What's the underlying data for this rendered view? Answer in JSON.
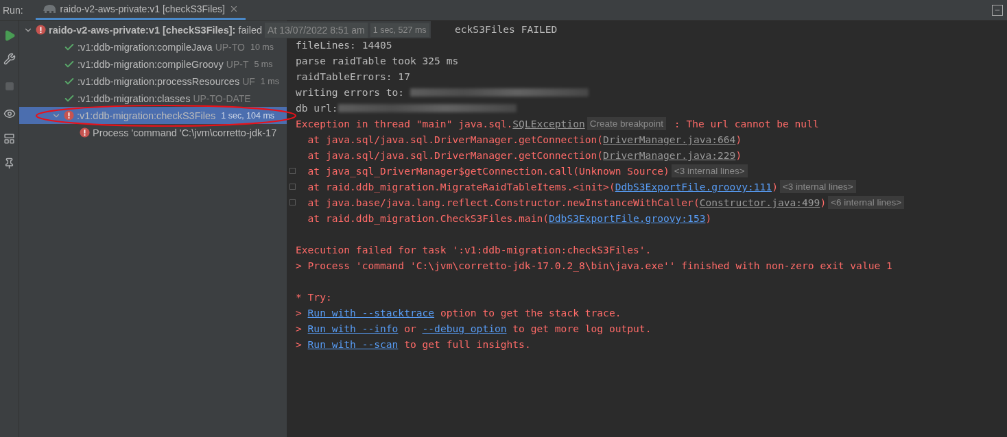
{
  "run_bar": {
    "label": "Run:",
    "tab": {
      "title": "raido-v2-aws-private:v1 [checkS3Files]",
      "selected": true
    }
  },
  "tree": {
    "root": {
      "name": "raido-v2-aws-private:v1 [checkS3Files]:",
      "status": "failed",
      "timestamp": "At 13/07/2022 8:51 am",
      "duration": "1 sec, 527 ms",
      "kind": "error",
      "expanded": true,
      "children": [
        {
          "name": ":v1:ddb-migration:compileJava",
          "status": "UP-TO",
          "duration": "10 ms",
          "kind": "ok",
          "selected": false
        },
        {
          "name": ":v1:ddb-migration:compileGroovy",
          "status": "UP-T",
          "duration": "5 ms",
          "kind": "ok",
          "selected": false
        },
        {
          "name": ":v1:ddb-migration:processResources",
          "status": "UF",
          "duration": "1 ms",
          "kind": "ok",
          "selected": false
        },
        {
          "name": ":v1:ddb-migration:classes",
          "status": "UP-TO-DATE",
          "kind": "ok",
          "selected": false
        },
        {
          "name": ":v1:ddb-migration:checkS3Files",
          "duration": "1 sec, 104 ms",
          "kind": "error",
          "selected": true,
          "expanded": true,
          "children": [
            {
              "name": "Process 'command 'C:\\jvm\\corretto-jdk-17",
              "kind": "error",
              "selected": false
            }
          ]
        }
      ]
    }
  },
  "console": {
    "lines": [
      {
        "kind": "normal",
        "covered_start": true,
        "segments": [
          {
            "kind": "text",
            "text": "eckS3Files FAILED"
          }
        ]
      },
      {
        "kind": "normal",
        "segments": [
          {
            "kind": "text",
            "text": "fileLines: 14405"
          }
        ]
      },
      {
        "kind": "normal",
        "segments": [
          {
            "kind": "text",
            "text": "parse raidTable took 325 ms"
          }
        ]
      },
      {
        "kind": "normal",
        "segments": [
          {
            "kind": "text",
            "text": "raidTableErrors: 17"
          }
        ]
      },
      {
        "kind": "normal",
        "segments": [
          {
            "kind": "text",
            "text": "writing errors to: "
          },
          {
            "kind": "redacted"
          }
        ]
      },
      {
        "kind": "normal",
        "segments": [
          {
            "kind": "text",
            "text": "db url:"
          },
          {
            "kind": "redacted"
          }
        ]
      },
      {
        "kind": "error",
        "segments": [
          {
            "kind": "text",
            "text": "Exception in thread \"main\" java.sql."
          },
          {
            "kind": "source",
            "text": "SQLException"
          },
          {
            "kind": "hint",
            "text": "Create breakpoint"
          },
          {
            "kind": "text",
            "text": " : The url cannot be null"
          }
        ]
      },
      {
        "kind": "error",
        "segments": [
          {
            "kind": "text",
            "text": "  at java.sql/java.sql.DriverManager.getConnection("
          },
          {
            "kind": "source",
            "text": "DriverManager.java:664"
          },
          {
            "kind": "text",
            "text": ")"
          }
        ]
      },
      {
        "kind": "error",
        "segments": [
          {
            "kind": "text",
            "text": "  at java.sql/java.sql.DriverManager.getConnection("
          },
          {
            "kind": "source",
            "text": "DriverManager.java:229"
          },
          {
            "kind": "text",
            "text": ")"
          }
        ]
      },
      {
        "kind": "error",
        "expandable": true,
        "segments": [
          {
            "kind": "text",
            "text": "  at java_sql_DriverManager$getConnection.call(Unknown Source)"
          },
          {
            "kind": "hint",
            "text": "<3 internal lines>"
          }
        ]
      },
      {
        "kind": "error",
        "expandable": true,
        "segments": [
          {
            "kind": "text",
            "text": "  at raid.ddb_migration.MigrateRaidTableItems.<init>("
          },
          {
            "kind": "link",
            "text": "DdbS3ExportFile.groovy:111"
          },
          {
            "kind": "text",
            "text": ")"
          },
          {
            "kind": "hint",
            "text": "<3 internal lines>"
          }
        ]
      },
      {
        "kind": "error",
        "expandable": true,
        "segments": [
          {
            "kind": "text",
            "text": "  at java.base/java.lang.reflect.Constructor.newInstanceWithCaller("
          },
          {
            "kind": "source",
            "text": "Constructor.java:499"
          },
          {
            "kind": "text",
            "text": ")"
          },
          {
            "kind": "hint",
            "text": "<6 internal lines>"
          }
        ]
      },
      {
        "kind": "error",
        "segments": [
          {
            "kind": "text",
            "text": "  at raid.ddb_migration.CheckS3Files.main("
          },
          {
            "kind": "link",
            "text": "DdbS3ExportFile.groovy:153"
          },
          {
            "kind": "text",
            "text": ")"
          }
        ]
      },
      {
        "kind": "blank"
      },
      {
        "kind": "error",
        "segments": [
          {
            "kind": "text",
            "text": "Execution failed for task ':v1:ddb-migration:checkS3Files'."
          }
        ]
      },
      {
        "kind": "error",
        "segments": [
          {
            "kind": "text",
            "text": "> Process 'command 'C:\\jvm\\corretto-jdk-17.0.2_8\\bin\\java.exe'' finished with non-zero exit value 1"
          }
        ]
      },
      {
        "kind": "blank"
      },
      {
        "kind": "error",
        "segments": [
          {
            "kind": "text",
            "text": "* Try:"
          }
        ]
      },
      {
        "kind": "error",
        "segments": [
          {
            "kind": "text",
            "text": "> "
          },
          {
            "kind": "link",
            "text": "Run with --stacktrace"
          },
          {
            "kind": "text",
            "text": " option to get the stack trace."
          }
        ]
      },
      {
        "kind": "error",
        "segments": [
          {
            "kind": "text",
            "text": "> "
          },
          {
            "kind": "link",
            "text": "Run with --info"
          },
          {
            "kind": "text",
            "text": " or "
          },
          {
            "kind": "link",
            "text": "--debug option"
          },
          {
            "kind": "text",
            "text": " to get more log output."
          }
        ]
      },
      {
        "kind": "error",
        "segments": [
          {
            "kind": "text",
            "text": "> "
          },
          {
            "kind": "link",
            "text": "Run with --scan"
          },
          {
            "kind": "text",
            "text": " to get full insights."
          }
        ]
      }
    ]
  }
}
